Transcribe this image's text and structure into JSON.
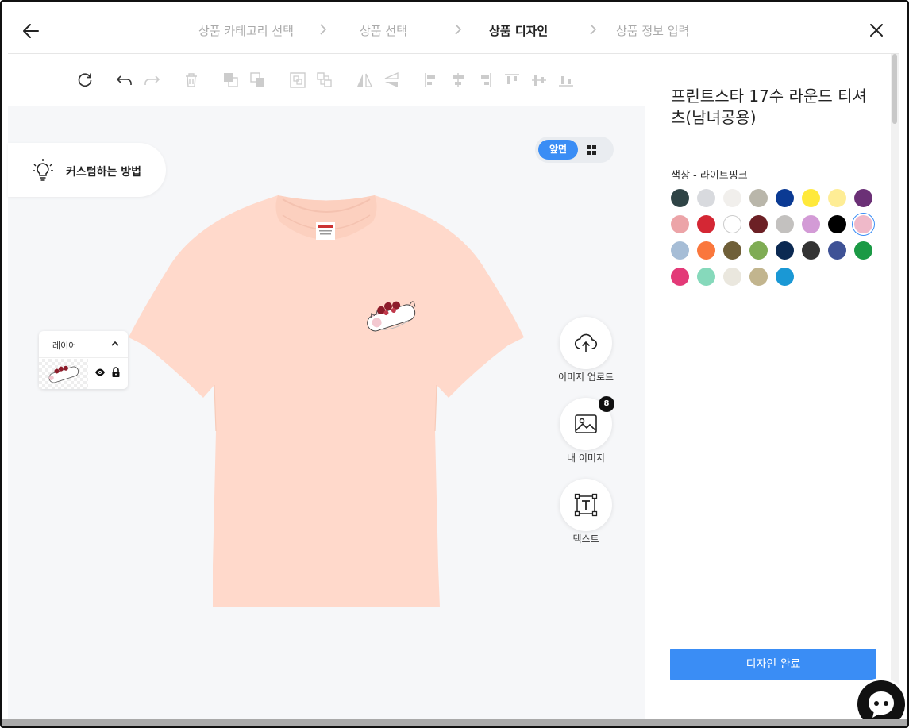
{
  "header": {
    "steps": [
      {
        "label": "상품 카테고리 선택"
      },
      {
        "label": "상품 선택"
      },
      {
        "label": "상품 디자인"
      },
      {
        "label": "상품 정보 입력"
      }
    ],
    "active_step": 2,
    "highlight_color": "#fff200"
  },
  "toolbar": {
    "icons": [
      "refresh-icon",
      "undo-icon",
      "redo-icon",
      "delete-icon",
      "bring-forward-icon",
      "send-backward-icon",
      "group-icon",
      "ungroup-icon",
      "flip-horizontal-icon",
      "flip-vertical-icon",
      "align-left-icon",
      "align-center-icon",
      "align-right-icon",
      "align-top-icon",
      "align-middle-icon",
      "align-bottom-icon"
    ]
  },
  "canvas": {
    "howto_label": "커스텀하는 방법",
    "view_front_label": "앞면",
    "layer": {
      "title": "레이어"
    },
    "tshirt_color": "#ffd9cb",
    "side_buttons": {
      "upload_label": "이미지 업로드",
      "my_images_label": "내 이미지",
      "my_images_count": "8",
      "text_label": "텍스트"
    }
  },
  "product": {
    "title": "프린트스타 17수 라운드 티셔츠(남녀공용)",
    "color_label": "색상  - 라이트핑크",
    "swatches": [
      "#2f4446",
      "#d8dade",
      "#f1efec",
      "#b9b6aa",
      "#0b3a93",
      "#ffe93b",
      "#feed95",
      "#6b3076",
      "#eca4a8",
      "#d42734",
      "#ffffff",
      "#6c2025",
      "#c3c1bf",
      "#d39bd6",
      "#000000",
      "#efb9c9",
      "#a6bdd6",
      "#fa773c",
      "#6f5f38",
      "#7fac54",
      "#0b2952",
      "#333333",
      "#3f5296",
      "#1b9a45",
      "#e33a78",
      "#86d9bb",
      "#eae7de",
      "#c2b58e",
      "#1a98d5"
    ],
    "selected_swatch": 15,
    "done_label": "디자인 완료",
    "accent_color": "#3a8df5"
  }
}
